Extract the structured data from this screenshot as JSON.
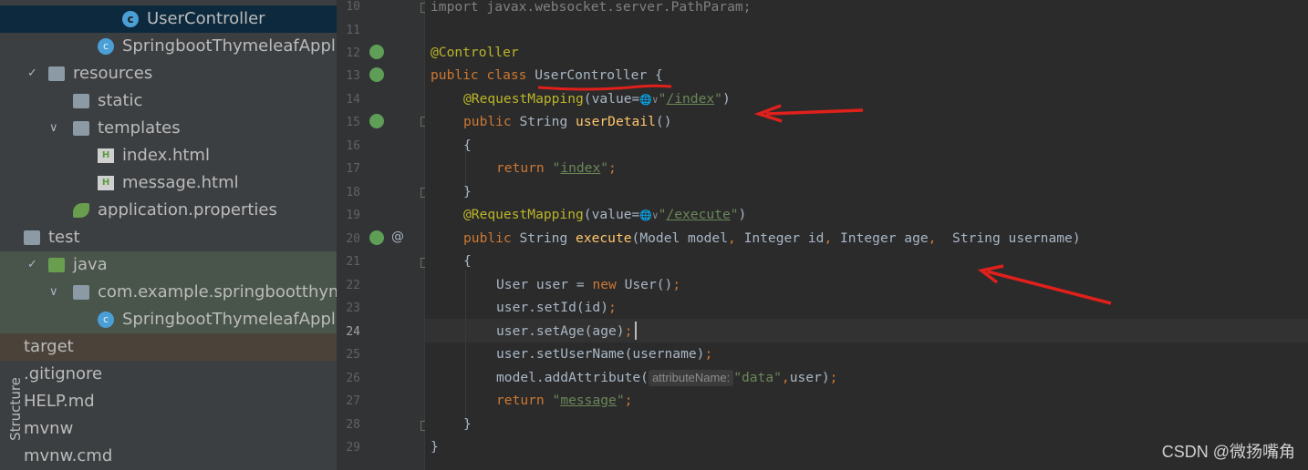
{
  "project_tree": [
    {
      "label": "UserController",
      "icon": "class-icon"
    },
    {
      "label": "SpringbootThymeleafApplication",
      "icon": "spring-boot-class-icon"
    },
    {
      "label": "resources",
      "icon": "resources-folder-icon"
    },
    {
      "label": "static",
      "icon": "folder-icon"
    },
    {
      "label": "templates",
      "icon": "folder-icon"
    },
    {
      "label": "index.html",
      "icon": "html-file-icon"
    },
    {
      "label": "message.html",
      "icon": "html-file-icon"
    },
    {
      "label": "application.properties",
      "icon": "spring-properties-icon"
    },
    {
      "label": "test",
      "icon": "folder-icon"
    },
    {
      "label": "java",
      "icon": "test-source-folder-icon"
    },
    {
      "label": "com.example.springbootthymeleaf",
      "icon": "package-icon"
    },
    {
      "label": "SpringbootThymeleafApplicationTests",
      "icon": "spring-boot-class-icon"
    },
    {
      "label": "target",
      "icon": "folder-icon"
    },
    {
      "label": ".gitignore",
      "icon": "file-icon"
    },
    {
      "label": "HELP.md",
      "icon": "file-icon"
    },
    {
      "label": "mvnw",
      "icon": "file-icon"
    },
    {
      "label": "mvnw.cmd",
      "icon": "file-icon"
    }
  ],
  "structure_tab": "Structure",
  "line_numbers": [
    "10",
    "11",
    "12",
    "13",
    "14",
    "15",
    "16",
    "17",
    "18",
    "19",
    "20",
    "21",
    "22",
    "23",
    "24",
    "25",
    "26",
    "27",
    "28",
    "29"
  ],
  "gutter_icons": {
    "bean": "spring-bean-icon",
    "at": "@"
  },
  "code": {
    "l10": "import javax.websocket.server.PathParam;",
    "l12": "@Controller",
    "l13_kw": "public class ",
    "l13_name": "UserController",
    "l13_end": " {",
    "l14_ann": "@RequestMapping",
    "l14_a": "(value=",
    "l14_q1": "\"",
    "l14_url": "/index",
    "l14_q2": "\"",
    "l14_end": ")",
    "l15_kw": "public ",
    "l15_type": "String ",
    "l15_fn": "userDetail",
    "l15_end": "()",
    "l16": "{",
    "l17_kw": "return ",
    "l17_q1": "\"",
    "l17_s": "index",
    "l17_q2": "\"",
    "l17_semi": ";",
    "l18": "}",
    "l19_ann": "@RequestMapping",
    "l19_a": "(value=",
    "l19_q1": "\"",
    "l19_url": "/execute",
    "l19_q2": "\"",
    "l19_end": ")",
    "l20_kw": "public ",
    "l20_type": "String ",
    "l20_fn": "execute",
    "l20_p1": "(Model model",
    "l20_c1": ", ",
    "l20_p2": "Integer id",
    "l20_c2": ", ",
    "l20_p3": "Integer age",
    "l20_c3": ",  ",
    "l20_p4": "String username)",
    "l21": "{",
    "l22_a": "User user = ",
    "l22_kw": "new ",
    "l22_b": "User()",
    "l22_semi": ";",
    "l23_a": "user.setId(id)",
    "l23_semi": ";",
    "l24_a": "user.setAge(age)",
    "l24_semi": ";",
    "l25_a": "user.setUserName(username)",
    "l25_semi": ";",
    "l26_a": "model.addAttribute(",
    "l26_hint": "attributeName:",
    "l26_s": "\"data\"",
    "l26_c": ",",
    "l26_b": "user)",
    "l26_semi": ";",
    "l27_kw": "return ",
    "l27_q1": "\"",
    "l27_s": "message",
    "l27_q2": "\"",
    "l27_semi": ";",
    "l28": "}",
    "l29": "}"
  },
  "watermark": "CSDN @微扬嘴角",
  "colors": {
    "editor_bg": "#2b2b2b",
    "panel_bg": "#3c3f41",
    "selection": "#0d293e",
    "keyword": "#cc7832",
    "annotation": "#bbb529",
    "string": "#6a8759",
    "method": "#ffc66d",
    "annotation_mark": "#e0201b"
  }
}
